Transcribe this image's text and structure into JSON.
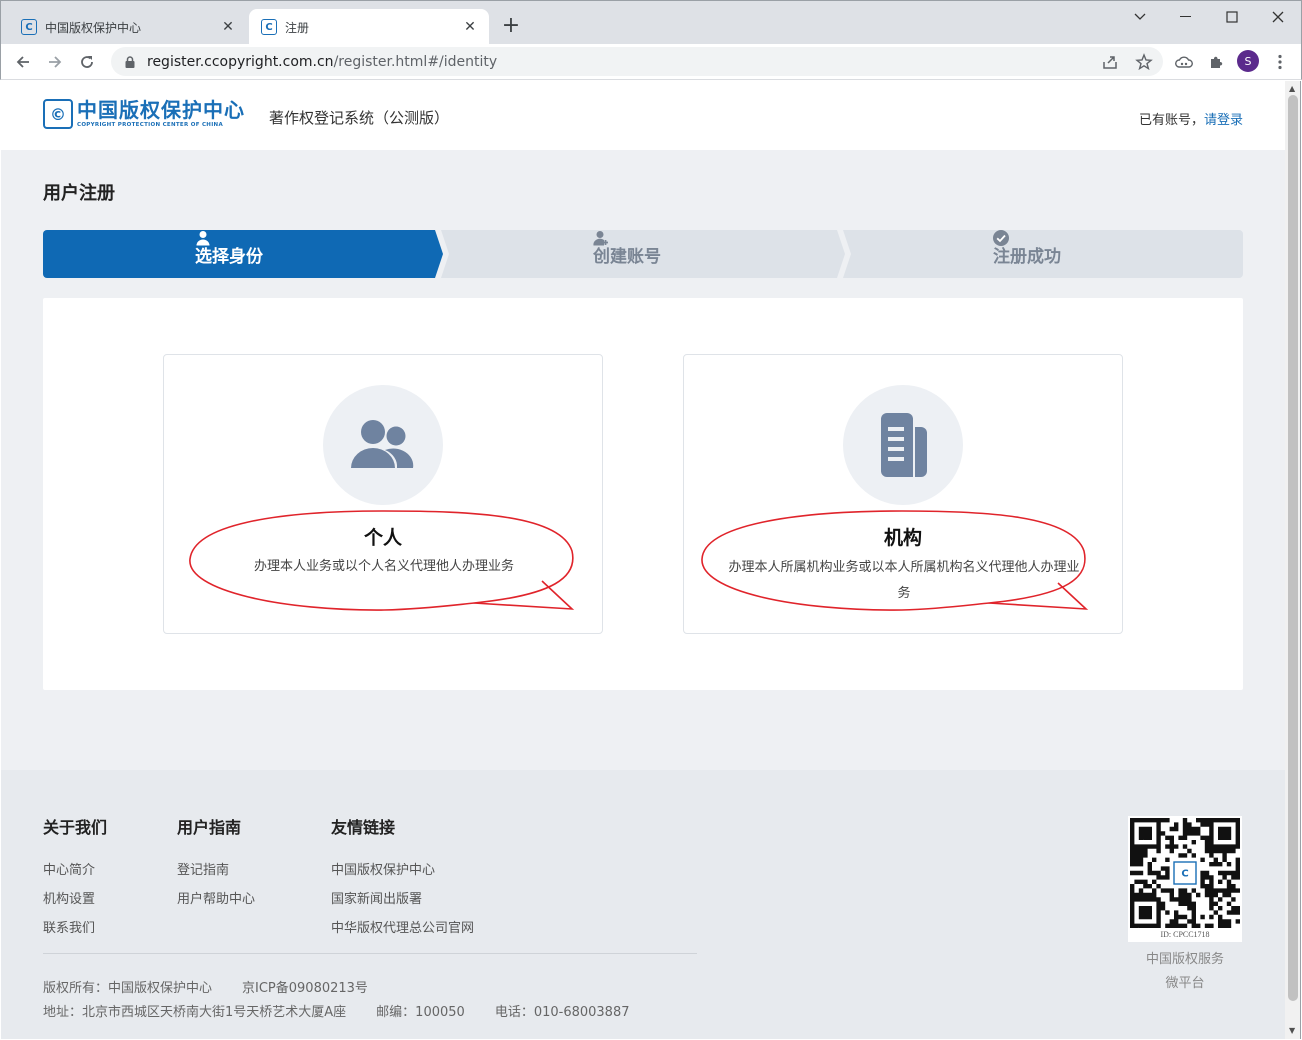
{
  "browser": {
    "tabs": [
      {
        "title": "中国版权保护中心",
        "favicon": "c-logo-icon",
        "active": false
      },
      {
        "title": "注册",
        "favicon": "c-logo-icon",
        "active": true
      }
    ],
    "url_host": "register.ccopyright.com.cn",
    "url_path": "/register.html#/identity",
    "profile_initial": "S"
  },
  "header": {
    "logo_cn": "中国版权保护中心",
    "logo_en": "COPYRIGHT PROTECTION CENTER OF CHINA",
    "logo_mark": "©",
    "system_name": "著作权登记系统（公测版）",
    "login_prompt": "已有账号，",
    "login_link": "请登录"
  },
  "page": {
    "title": "用户注册",
    "steps": [
      {
        "label": "选择身份",
        "icon": "user-icon",
        "active": true
      },
      {
        "label": "创建账号",
        "icon": "user-add-icon",
        "active": false
      },
      {
        "label": "注册成功",
        "icon": "check-circle-icon",
        "active": false
      }
    ],
    "cards": [
      {
        "title": "个人",
        "desc": "办理本人业务或以个人名义代理他人办理业务",
        "icon": "users-icon"
      },
      {
        "title": "机构",
        "desc": "办理本人所属机构业务或以本人所属机构名义代理他人办理业务",
        "icon": "building-icon"
      }
    ]
  },
  "footer": {
    "columns": [
      {
        "heading": "关于我们",
        "links": [
          "中心简介",
          "机构设置",
          "联系我们"
        ]
      },
      {
        "heading": "用户指南",
        "links": [
          "登记指南",
          "用户帮助中心"
        ]
      },
      {
        "heading": "友情链接",
        "links": [
          "中国版权保护中心",
          "国家新闻出版署",
          "中华版权代理总公司官网"
        ]
      }
    ],
    "copyright": "版权所有：中国版权保护中心",
    "icp": "京ICP备09080213号",
    "address": "地址：北京市西城区天桥南大街1号天桥艺术大厦A座",
    "postcode": "邮编：100050",
    "phone": "电话：010-68003887",
    "qr_id": "ID: CPCC1718",
    "qr_caption_1": "中国版权服务",
    "qr_caption_2": "微平台"
  },
  "colors": {
    "brand_blue": "#1a6fb7",
    "step_active": "#0f69b4",
    "step_inactive": "#dde2e8",
    "highlight_red": "#e0242b"
  }
}
